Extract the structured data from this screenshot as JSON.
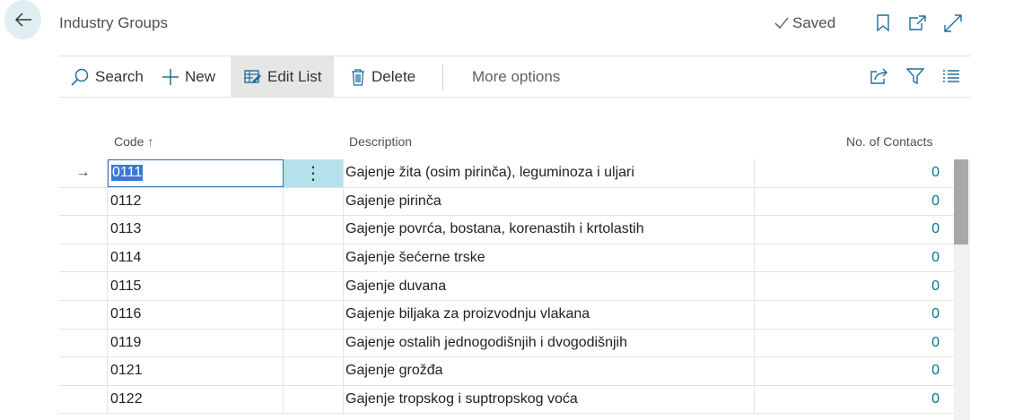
{
  "header": {
    "title": "Industry Groups",
    "saved_label": "Saved"
  },
  "toolbar": {
    "search_label": "Search",
    "new_label": "New",
    "edit_list_label": "Edit List",
    "delete_label": "Delete",
    "more_label": "More options"
  },
  "columns": {
    "code": "Code",
    "code_sort": "↑",
    "description": "Description",
    "contacts": "No. of Contacts"
  },
  "rows": [
    {
      "code": "0111",
      "description": "Gajenje žita (osim pirinča), leguminoza i uljari",
      "contacts": "0"
    },
    {
      "code": "0112",
      "description": "Gajenje pirinča",
      "contacts": "0"
    },
    {
      "code": "0113",
      "description": "Gajenje povrća,  bostana, korenastih i krtolastih",
      "contacts": "0"
    },
    {
      "code": "0114",
      "description": "Gajenje šećerne  trske",
      "contacts": "0"
    },
    {
      "code": "0115",
      "description": "Gajenje duvana",
      "contacts": "0"
    },
    {
      "code": "0116",
      "description": "Gajenje biljaka za proizvodnju vlakana",
      "contacts": "0"
    },
    {
      "code": "0119",
      "description": "Gajenje ostalih jednogodišnjih i dvogodišnjih",
      "contacts": "0"
    },
    {
      "code": "0121",
      "description": "Gajenje grožđa",
      "contacts": "0"
    },
    {
      "code": "0122",
      "description": "Gajenje tropskog i suptropskog voća",
      "contacts": "0"
    }
  ],
  "current_row": {
    "arrow": "→",
    "menu": "⋮"
  },
  "colors": {
    "accent": "#00758f",
    "selection": "#3a78d6",
    "row_menu_bg": "#b5e2ea",
    "back_bg": "#dfeff1"
  }
}
